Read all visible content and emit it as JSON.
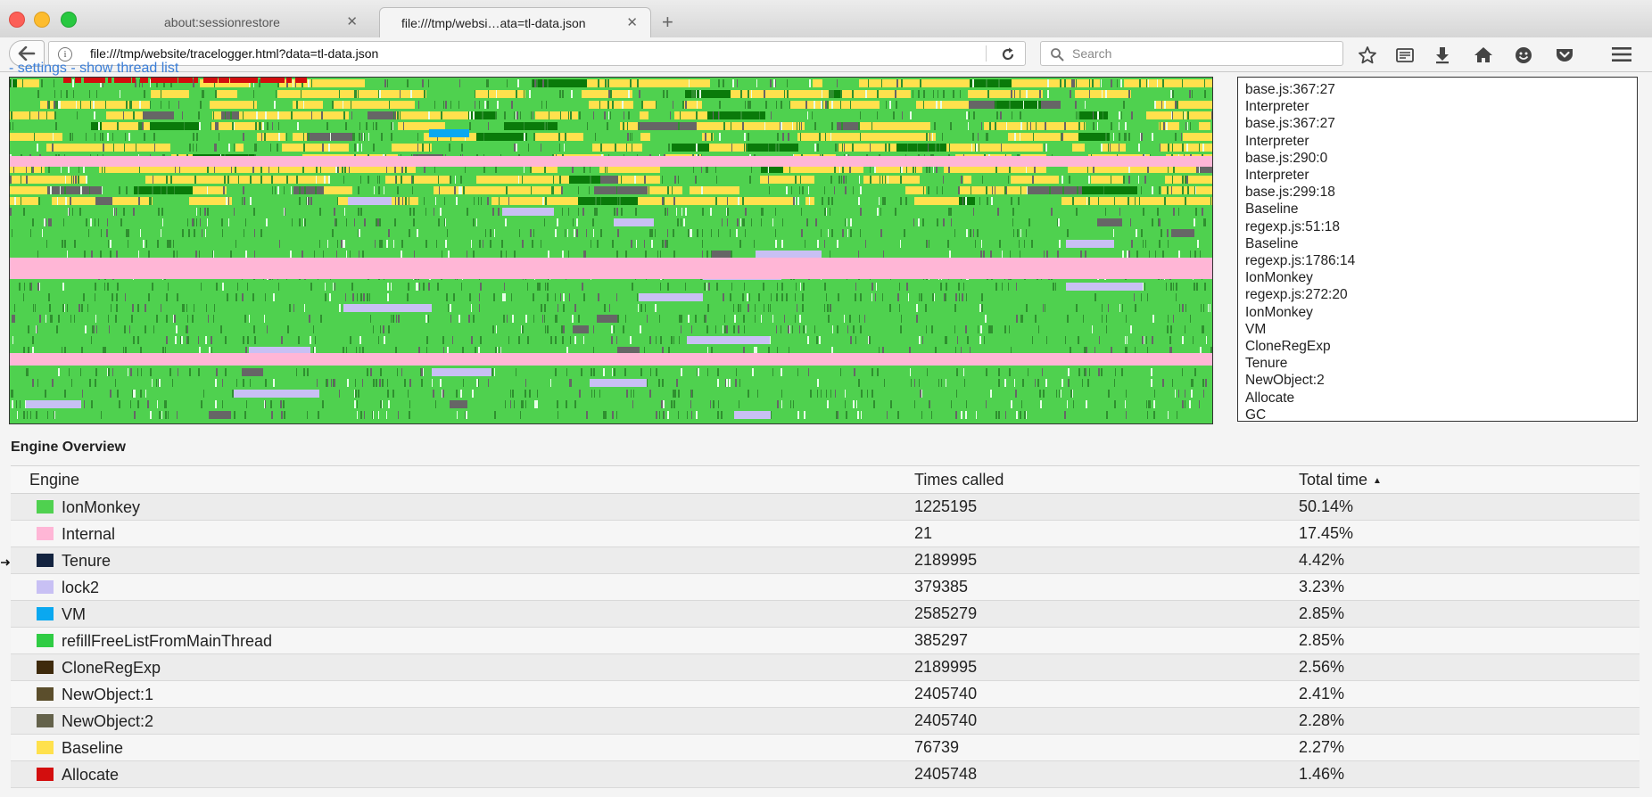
{
  "tabs": [
    {
      "label": "about:sessionrestore",
      "close": "✕"
    },
    {
      "label": "file:///tmp/websi…ata=tl-data.json",
      "close": "✕"
    }
  ],
  "newtab": "+",
  "urlbar": {
    "url": "file:///tmp/website/tracelogger.html?data=tl-data.json"
  },
  "searchbar": {
    "placeholder": "Search"
  },
  "toolbar_icons": [
    "bookmark-star-icon",
    "reading-list-icon",
    "download-icon",
    "home-icon",
    "hello-icon",
    "pocket-icon",
    "hamburger-menu-icon"
  ],
  "page": {
    "settings_link": "- settings - show thread list",
    "stack": [
      "base.js:367:27",
      "Interpreter",
      "base.js:367:27",
      "Interpreter",
      "base.js:290:0",
      "Interpreter",
      "base.js:299:18",
      "Baseline",
      "regexp.js:51:18",
      "Baseline",
      "regexp.js:1786:14",
      "IonMonkey",
      "regexp.js:272:20",
      "IonMonkey",
      "VM",
      "CloneRegExp",
      "Tenure",
      "NewObject:2",
      "Allocate",
      "GC"
    ],
    "overview": {
      "heading": "Engine Overview",
      "columns": {
        "engine": "Engine",
        "calls": "Times called",
        "time": "Total time",
        "sort_indicator": "▲"
      },
      "rows": [
        {
          "name": "IonMonkey",
          "calls": "1225195",
          "time": "50.14%",
          "color": "#4fd14f"
        },
        {
          "name": "Internal",
          "calls": "21",
          "time": "17.45%",
          "color": "#ffb6d6"
        },
        {
          "name": "Tenure",
          "calls": "2189995",
          "time": "4.42%",
          "color": "#13233f"
        },
        {
          "name": "lock2",
          "calls": "379385",
          "time": "3.23%",
          "color": "#c8c0f4"
        },
        {
          "name": "VM",
          "calls": "2585279",
          "time": "2.85%",
          "color": "#0aa8f0"
        },
        {
          "name": "refillFreeListFromMainThread",
          "calls": "385297",
          "time": "2.85%",
          "color": "#2fcc44"
        },
        {
          "name": "CloneRegExp",
          "calls": "2189995",
          "time": "2.56%",
          "color": "#3e2a0c"
        },
        {
          "name": "NewObject:1",
          "calls": "2405740",
          "time": "2.41%",
          "color": "#5b4e2c"
        },
        {
          "name": "NewObject:2",
          "calls": "2405740",
          "time": "2.28%",
          "color": "#64624b"
        },
        {
          "name": "Baseline",
          "calls": "76739",
          "time": "2.27%",
          "color": "#ffe14d"
        },
        {
          "name": "Allocate",
          "calls": "2405748",
          "time": "1.46%",
          "color": "#d30e0e"
        }
      ]
    }
  },
  "colors": {
    "ion": "#4fd14f",
    "internal": "#ffb6d6",
    "baseline": "#ffe14d",
    "dark_green": "#0a7a0a",
    "gray": "#666666",
    "lavender": "#c8c0f4",
    "red": "#d30e0e",
    "blue": "#0aa8f0"
  }
}
